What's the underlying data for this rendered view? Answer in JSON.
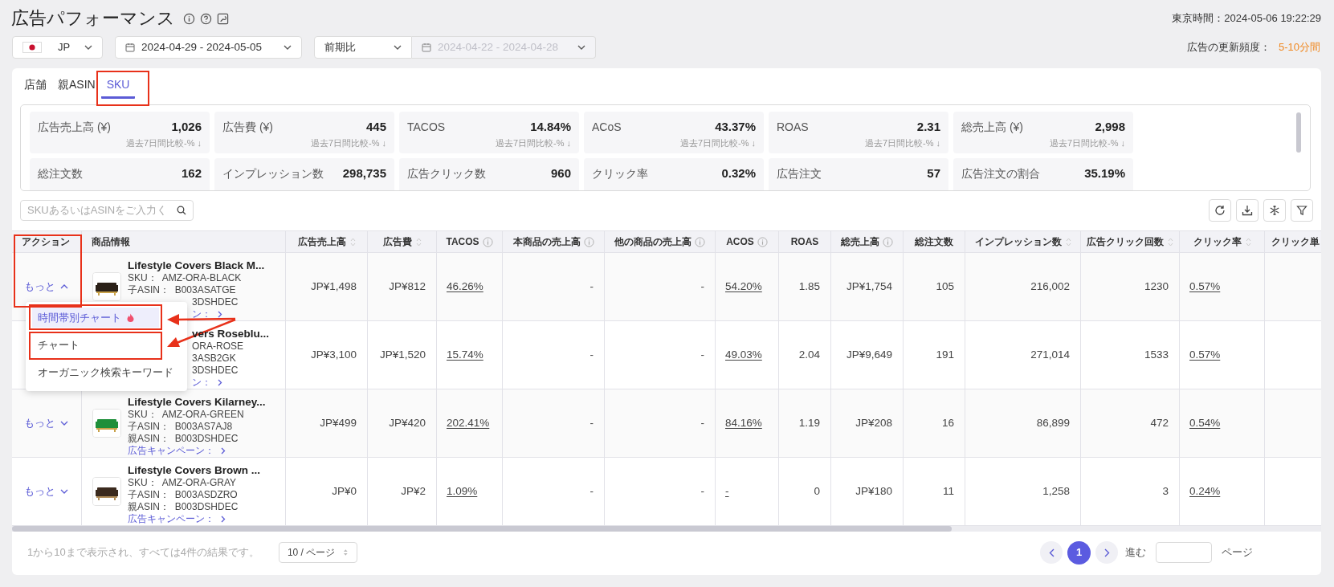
{
  "header": {
    "title": "広告パフォーマンス",
    "clock": "東京時間：2024-05-06 19:22:29"
  },
  "filters": {
    "marketplace": "JP",
    "date_range": "2024-04-29 - 2024-05-05",
    "compare": "前期比",
    "compare_range": "2024-04-22 - 2024-04-28",
    "compare_range_disabled": true,
    "update_label": "広告の更新頻度：",
    "update_value": "5-10分間"
  },
  "tabs": [
    {
      "label": "店舗",
      "selected": false
    },
    {
      "label": "親ASIN",
      "selected": false
    },
    {
      "label": "SKU",
      "selected": true
    }
  ],
  "metrics": [
    {
      "label": "広告売上高 (¥)",
      "value": "1,026",
      "note": "過去7日間比較-% ↓"
    },
    {
      "label": "広告費 (¥)",
      "value": "445",
      "note": "過去7日間比較-% ↓"
    },
    {
      "label": "TACOS",
      "value": "14.84%",
      "note": "過去7日間比較-% ↓"
    },
    {
      "label": "ACoS",
      "value": "43.37%",
      "note": "過去7日間比較-% ↓"
    },
    {
      "label": "ROAS",
      "value": "2.31",
      "note": "過去7日間比較-% ↓"
    },
    {
      "label": "総売上高 (¥)",
      "value": "2,998",
      "note": "過去7日間比較-% ↓"
    },
    {
      "label": "総注文数",
      "value": "162"
    },
    {
      "label": "インプレッション数",
      "value": "298,735"
    },
    {
      "label": "広告クリック数",
      "value": "960"
    },
    {
      "label": "クリック率",
      "value": "0.32%"
    },
    {
      "label": "広告注文",
      "value": "57"
    },
    {
      "label": "広告注文の割合",
      "value": "35.19%"
    }
  ],
  "search": {
    "placeholder": "SKUあるいはASINをご入力く"
  },
  "table": {
    "action_header": "アクション",
    "product_header": "商品情報",
    "columns": [
      {
        "label": "広告売上高",
        "kind": "sortable"
      },
      {
        "label": "広告費",
        "kind": "sortable"
      },
      {
        "label": "TACOS",
        "kind": "info_link"
      },
      {
        "label": "本商品の売上高",
        "kind": "info"
      },
      {
        "label": "他の商品の売上高",
        "kind": "info"
      },
      {
        "label": "ACOS",
        "kind": "info_link"
      },
      {
        "label": "ROAS",
        "kind": "plain"
      },
      {
        "label": "総売上高",
        "kind": "info"
      },
      {
        "label": "総注文数",
        "kind": "plain"
      },
      {
        "label": "インプレッション数",
        "kind": "sortable"
      },
      {
        "label": "広告クリック回数",
        "kind": "sortable"
      },
      {
        "label": "クリック率",
        "kind": "sortable_link"
      },
      {
        "label": "クリック単",
        "kind": "plain"
      }
    ],
    "rows": [
      {
        "action": {
          "label": "もっと",
          "expanded": true
        },
        "image": {
          "kind": "picture"
        },
        "product": [
          {
            "kind": "name",
            "text": "Lifestyle Covers Black M..."
          },
          {
            "kind": "field",
            "text": "SKU：  AMZ-ORA-BLACK"
          },
          {
            "kind": "field",
            "text": "子ASIN：  B003ASATGE"
          },
          {
            "kind": "field_fragment",
            "text": "3DSHDEC"
          },
          {
            "kind": "link_fragment",
            "text": "ン："
          }
        ],
        "cells": [
          "JP¥1,498",
          "JP¥812",
          "46.26%",
          "-",
          "-",
          "54.20%",
          "1.85",
          "JP¥1,754",
          "105",
          "216,002",
          "1230",
          "0.57%"
        ]
      },
      {
        "product": [
          {
            "kind": "name_fragment",
            "text": "vers Roseblu..."
          },
          {
            "kind": "field_fragment",
            "text": "ORA-ROSE"
          },
          {
            "kind": "field_fragment",
            "text": "3ASB2GK"
          },
          {
            "kind": "field_fragment",
            "text": "3DSHDEC"
          },
          {
            "kind": "link_fragment",
            "text": "ン："
          }
        ],
        "cells": [
          "JP¥3,100",
          "JP¥1,520",
          "15.74%",
          "-",
          "-",
          "49.03%",
          "2.04",
          "JP¥9,649",
          "191",
          "271,014",
          "1533",
          "0.57%"
        ]
      },
      {
        "action": {
          "label": "もっと",
          "expanded": false
        },
        "image": {
          "kind": "picture"
        },
        "product": [
          {
            "kind": "name",
            "text": "Lifestyle Covers Kilarney..."
          },
          {
            "kind": "field",
            "text": "SKU：  AMZ-ORA-GREEN"
          },
          {
            "kind": "field",
            "text": "子ASIN：  B003AS7AJ8"
          },
          {
            "kind": "field",
            "text": "親ASIN：  B003DSHDEC"
          },
          {
            "kind": "link",
            "text": "広告キャンペーン："
          }
        ],
        "cells": [
          "JP¥499",
          "JP¥420",
          "202.41%",
          "-",
          "-",
          "84.16%",
          "1.19",
          "JP¥208",
          "16",
          "86,899",
          "472",
          "0.54%"
        ]
      },
      {
        "action": {
          "label": "もっと",
          "expanded": false
        },
        "image": {
          "kind": "picture"
        },
        "product": [
          {
            "kind": "name",
            "text": "Lifestyle Covers Brown ..."
          },
          {
            "kind": "field",
            "text": "SKU：  AMZ-ORA-GRAY"
          },
          {
            "kind": "field",
            "text": "子ASIN：  B003ASDZRO"
          },
          {
            "kind": "field",
            "text": "親ASIN：  B003DSHDEC"
          },
          {
            "kind": "link",
            "text": "広告キャンペーン："
          }
        ],
        "cells": [
          "JP¥0",
          "JP¥2",
          "1.09%",
          "-",
          "-",
          "-",
          "0",
          "JP¥180",
          "11",
          "1,258",
          "3",
          "0.24%"
        ]
      }
    ]
  },
  "action_menu": {
    "items": [
      {
        "label": "時間帯別チャート",
        "selected": true,
        "hot": true
      },
      {
        "label": "チャート",
        "selected": false,
        "hot": false
      },
      {
        "label": "オーガニック検索キーワード",
        "selected": false,
        "hot": false
      }
    ]
  },
  "footer": {
    "summary": "1から10まで表示され、すべては4件の結果です。",
    "page_size": "10 / ページ",
    "pages": [
      {
        "label": "1",
        "selected": true
      }
    ],
    "goto_label": "進む",
    "page_suffix": "ページ"
  }
}
